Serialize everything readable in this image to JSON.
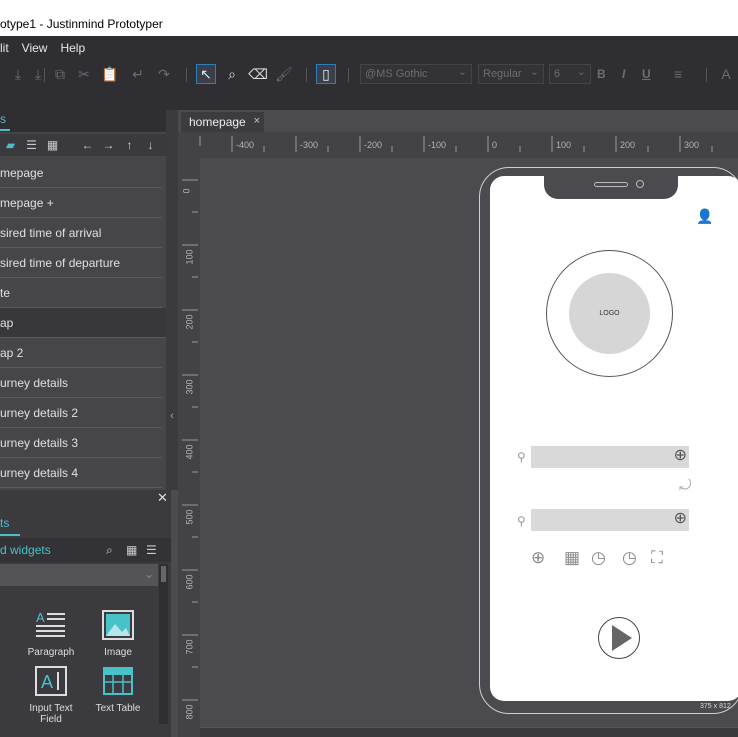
{
  "window": {
    "title": "otype1 - Justinmind Prototyper"
  },
  "menu": [
    "lit",
    "View",
    "Help"
  ],
  "toolbar": {
    "font_family": "@MS Gothic",
    "font_style": "Regular",
    "font_size": "6",
    "bold": "B",
    "italic": "I",
    "underline": "U"
  },
  "pages_panel": {
    "tab_label": "s",
    "pages": [
      {
        "label": "mepage"
      },
      {
        "label": "mepage +"
      },
      {
        "label": "sired time of arrival"
      },
      {
        "label": "sired time of departure"
      },
      {
        "label": "te"
      },
      {
        "label": "ap"
      },
      {
        "label": "ap 2"
      },
      {
        "label": "urney details"
      },
      {
        "label": "urney details 2"
      },
      {
        "label": "urney details 3"
      },
      {
        "label": "urney details 4"
      }
    ]
  },
  "widgets_panel": {
    "tab_label": "ts",
    "library_label": "d widgets",
    "items": [
      {
        "label": "Paragraph",
        "icon": "paragraph-icon"
      },
      {
        "label": "Image",
        "icon": "image-icon"
      },
      {
        "label": "Input Text Field",
        "icon": "input-text-field-icon"
      },
      {
        "label": "Text Table",
        "icon": "text-table-icon"
      }
    ]
  },
  "document_tab": {
    "label": "homepage",
    "close": "×"
  },
  "ruler": {
    "h": [
      "-400",
      "-300",
      "-200",
      "-100",
      "0",
      "100",
      "200",
      "300"
    ],
    "v": [
      "0",
      "100",
      "200",
      "300",
      "400",
      "500",
      "600",
      "700",
      "800"
    ]
  },
  "device": {
    "logo_text": "LOGO",
    "dimensions": "375 x 812"
  },
  "colors": {
    "accent": "#49c1c9",
    "chrome": "#2f2f33",
    "canvas": "#4a4a4f"
  }
}
